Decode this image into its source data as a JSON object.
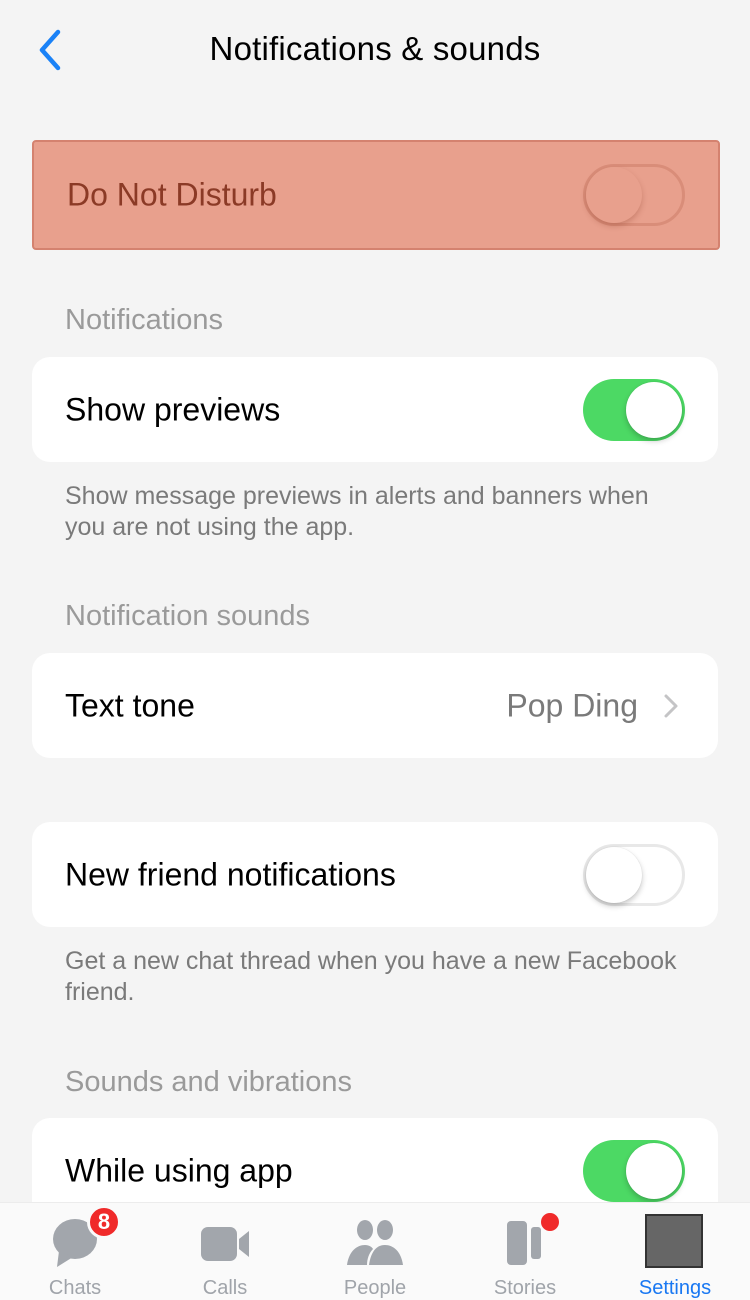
{
  "header": {
    "title": "Notifications & sounds",
    "back_icon": "chevron-left-icon"
  },
  "dnd": {
    "label": "Do Not Disturb",
    "enabled": false
  },
  "notifications": {
    "header": "Notifications",
    "show_previews": {
      "label": "Show previews",
      "enabled": true
    },
    "footnote": "Show message previews in alerts and banners when you are not using the app."
  },
  "notification_sounds": {
    "header": "Notification sounds",
    "text_tone": {
      "label": "Text tone",
      "value": "Pop Ding"
    }
  },
  "new_friend": {
    "label": "New friend notifications",
    "enabled": false,
    "footnote": "Get a new chat thread when you have a new Facebook friend."
  },
  "sounds_vibrations": {
    "header": "Sounds and vibrations",
    "while_using_app": {
      "label": "While using app",
      "enabled": true
    }
  },
  "tab_bar": {
    "tabs": [
      {
        "label": "Chats",
        "icon": "chat-bubble-icon",
        "badge": "8"
      },
      {
        "label": "Calls",
        "icon": "video-camera-icon"
      },
      {
        "label": "People",
        "icon": "people-icon"
      },
      {
        "label": "Stories",
        "icon": "stories-icon",
        "dot": true
      },
      {
        "label": "Settings",
        "icon": "settings-avatar",
        "active": true
      }
    ]
  },
  "colors": {
    "accent": "#1877f2",
    "toggle_on": "#4cd964",
    "badge": "#f02a2a",
    "dnd_highlight": "#e8a08d"
  }
}
